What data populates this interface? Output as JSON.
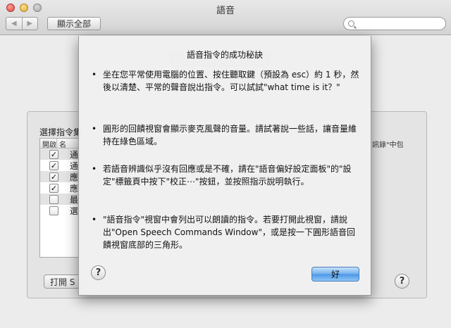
{
  "window": {
    "title": "語音",
    "show_all_label": "顯示全部",
    "back_glyph": "◀",
    "forward_glyph": "▶",
    "search_icon": "search-icon"
  },
  "background": {
    "list_label": "選擇指令集",
    "list_headers": [
      "開啟",
      "名"
    ],
    "rows": [
      {
        "checked": true,
        "text": "通"
      },
      {
        "checked": true,
        "text": "通"
      },
      {
        "checked": true,
        "text": "應"
      },
      {
        "checked": true,
        "text": "應"
      },
      {
        "checked": false,
        "text": "最"
      },
      {
        "checked": false,
        "text": "選"
      }
    ],
    "open_button_label": "打開 S",
    "right_text": "訊錄\"中包",
    "help_glyph": "?"
  },
  "sheet": {
    "title": "語音指令的成功秘訣",
    "bullet_glyph": "•",
    "tips": [
      "坐在您平常使用電腦的位置、按住聽取鍵（預設為 esc）約 1 秒，然後以清楚、平常的聲音說出指令。可以試試\"what time is it？\"",
      "圓形的回饋視窗會顯示麥克風聲的音量。請試著說一些話，讓音量維持在綠色區域。",
      "若語音辨識似乎沒有回應或是不確，請在\"語音偏好設定面板\"的\"設定\"標籤頁中按下\"校正⋯\"按鈕，並按照指示說明執行。",
      "\"語音指令\"視窗中會列出可以朗讀的指令。若要打開此視窗，請說出\"Open Speech Commands Window\"，或是按一下圓形語音回饋視窗底部的三角形。"
    ],
    "help_glyph": "?",
    "ok_label": "好"
  },
  "colors": {
    "ok_button": "#5aa2ea",
    "window_bg": "#ececec"
  }
}
